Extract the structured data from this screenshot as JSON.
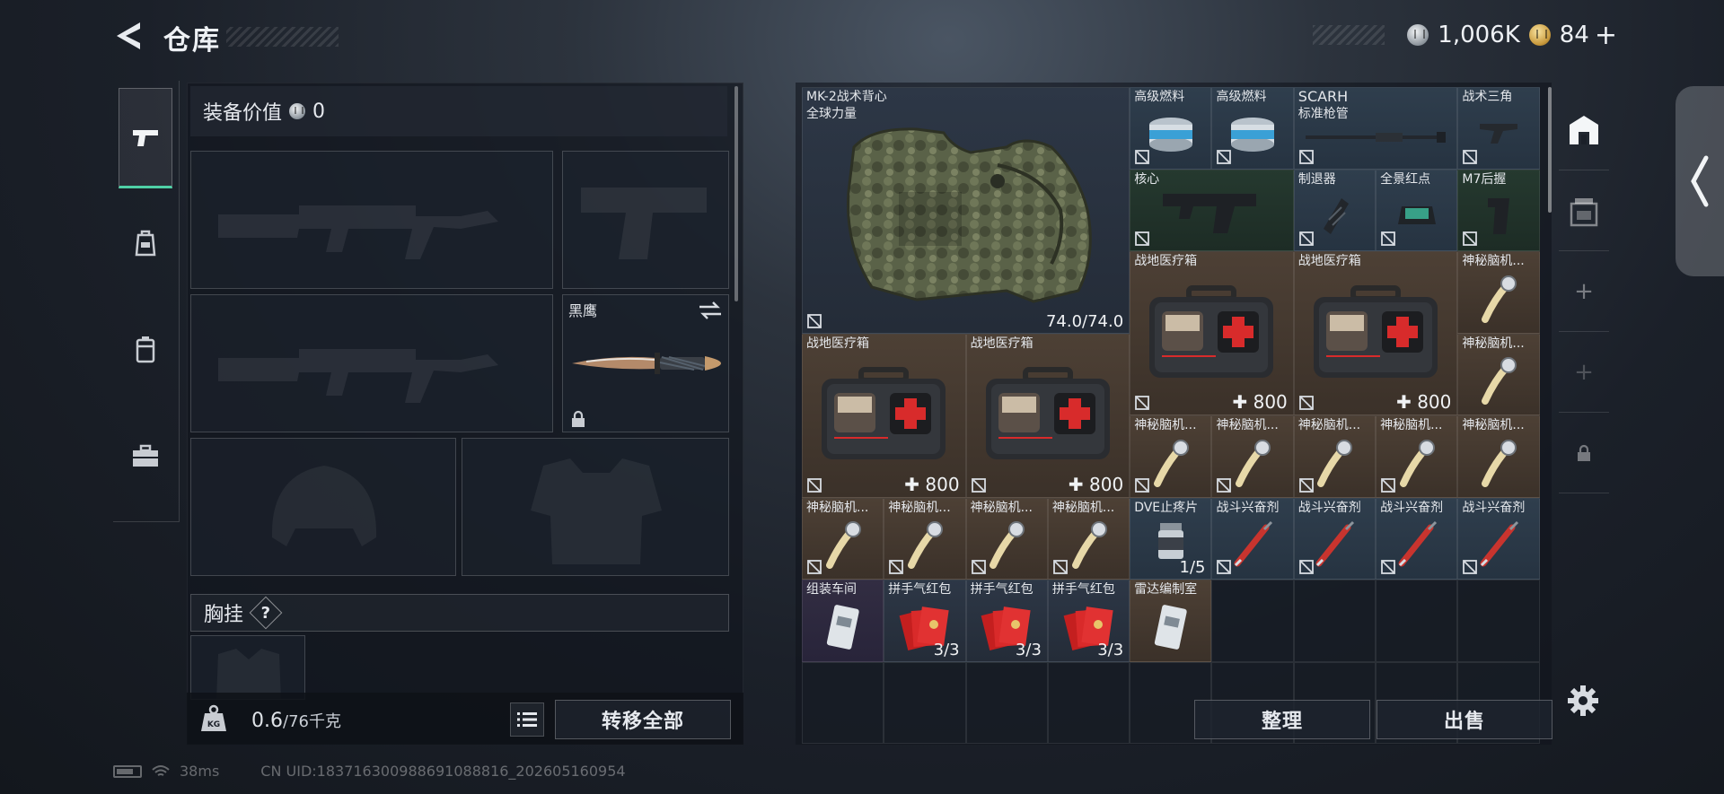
{
  "header": {
    "title": "仓库",
    "silver_amount": "1,006K",
    "gold_amount": "84"
  },
  "equipment": {
    "value_label": "装备价值",
    "value": "0",
    "knife_name": "黑鹰",
    "chest_label": "胸挂",
    "chest_help": "?",
    "weight_value": "0.6",
    "weight_max": "/76千克",
    "transfer_label": "转移全部"
  },
  "inventory": {
    "vest_name": "MK-2战术背心",
    "vest_sub": "全球力量",
    "vest_durability": "74.0/74.0",
    "fuel_1": "高级燃料",
    "fuel_2": "高级燃料",
    "scarh_name": "SCARH",
    "scarh_sub": "标准枪管",
    "tri_name": "战术三角",
    "core_name": "核心",
    "suppressor_name": "制退器",
    "redsight_name": "全景红点",
    "m7grip_name": "M7后握",
    "medkit_name": "战地医疗箱",
    "medkit_count": "800",
    "brain_name": "神秘脑机...",
    "dve_name": "DVE止疼片",
    "dve_count": "1/5",
    "stim_name": "战斗兴奋剂",
    "assembly_name": "组装车间",
    "redpack_name": "拼手气红包",
    "redpack_count": "3/3",
    "radar_name": "雷达编制室",
    "sort_label": "整理",
    "sell_label": "出售"
  },
  "status": {
    "ping": "38ms",
    "uid": "CN UID:183716300988691088816_202605160954"
  },
  "colors": {
    "accent_green": "#4fd0a6",
    "tile_brown": "#4d4035",
    "tile_blue": "#2f3e4d",
    "tile_green": "#25392f"
  }
}
